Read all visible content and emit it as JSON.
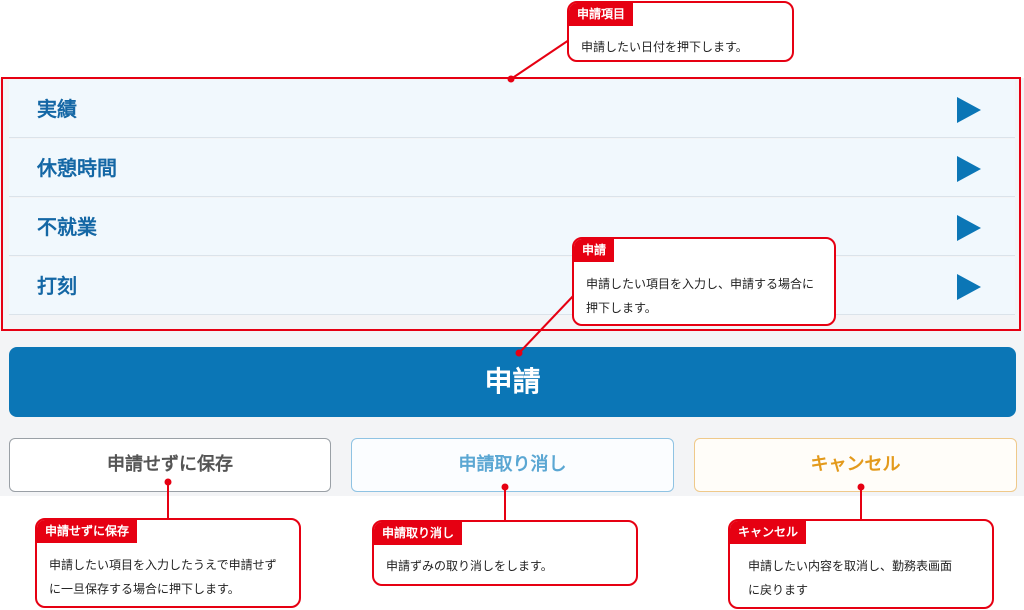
{
  "list": {
    "items": [
      {
        "label": "実績"
      },
      {
        "label": "休憩時間"
      },
      {
        "label": "不就業"
      },
      {
        "label": "打刻"
      }
    ]
  },
  "buttons": {
    "apply": "申請",
    "save_without_apply": "申請せずに保存",
    "withdraw": "申請取り消し",
    "cancel": "キャンセル"
  },
  "callouts": {
    "items_header": {
      "tag": "申請項目",
      "text": "申請したい日付を押下します。"
    },
    "apply": {
      "tag": "申請",
      "text": "申請したい項目を入力し、申請する場合に押下します。"
    },
    "save": {
      "tag": "申請せずに保存",
      "text": "申請したい項目を入力したうえで申請せずに一旦保存する場合に押下します。"
    },
    "withdraw": {
      "tag": "申請取り消し",
      "text": "申請ずみの取り消しをします。"
    },
    "cancel": {
      "tag": "キャンセル",
      "text": "申請したい内容を取消し、勤務表画面に戻ります"
    }
  },
  "colors": {
    "accent": "#0b76b6",
    "annotation": "#e60012",
    "label_blue": "#1467a5",
    "cancel_orange": "#e39a1c"
  },
  "icons": {
    "row_arrow": "play-arrow-icon"
  }
}
